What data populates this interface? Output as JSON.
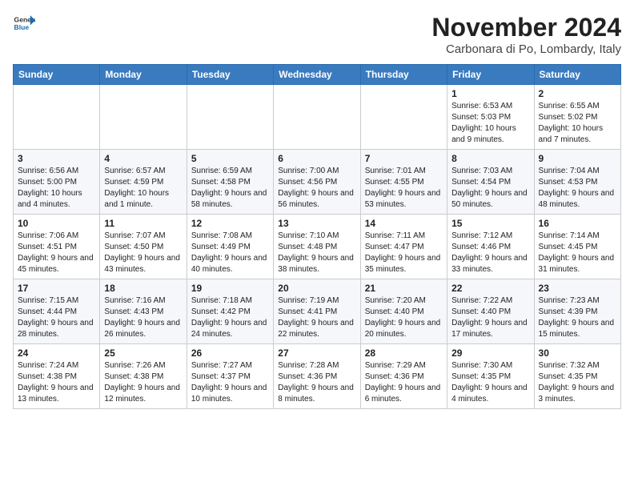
{
  "header": {
    "logo_line1": "General",
    "logo_line2": "Blue",
    "month_title": "November 2024",
    "location": "Carbonara di Po, Lombardy, Italy"
  },
  "weekdays": [
    "Sunday",
    "Monday",
    "Tuesday",
    "Wednesday",
    "Thursday",
    "Friday",
    "Saturday"
  ],
  "weeks": [
    [
      {
        "day": "",
        "info": ""
      },
      {
        "day": "",
        "info": ""
      },
      {
        "day": "",
        "info": ""
      },
      {
        "day": "",
        "info": ""
      },
      {
        "day": "",
        "info": ""
      },
      {
        "day": "1",
        "info": "Sunrise: 6:53 AM\nSunset: 5:03 PM\nDaylight: 10 hours and 9 minutes."
      },
      {
        "day": "2",
        "info": "Sunrise: 6:55 AM\nSunset: 5:02 PM\nDaylight: 10 hours and 7 minutes."
      }
    ],
    [
      {
        "day": "3",
        "info": "Sunrise: 6:56 AM\nSunset: 5:00 PM\nDaylight: 10 hours and 4 minutes."
      },
      {
        "day": "4",
        "info": "Sunrise: 6:57 AM\nSunset: 4:59 PM\nDaylight: 10 hours and 1 minute."
      },
      {
        "day": "5",
        "info": "Sunrise: 6:59 AM\nSunset: 4:58 PM\nDaylight: 9 hours and 58 minutes."
      },
      {
        "day": "6",
        "info": "Sunrise: 7:00 AM\nSunset: 4:56 PM\nDaylight: 9 hours and 56 minutes."
      },
      {
        "day": "7",
        "info": "Sunrise: 7:01 AM\nSunset: 4:55 PM\nDaylight: 9 hours and 53 minutes."
      },
      {
        "day": "8",
        "info": "Sunrise: 7:03 AM\nSunset: 4:54 PM\nDaylight: 9 hours and 50 minutes."
      },
      {
        "day": "9",
        "info": "Sunrise: 7:04 AM\nSunset: 4:53 PM\nDaylight: 9 hours and 48 minutes."
      }
    ],
    [
      {
        "day": "10",
        "info": "Sunrise: 7:06 AM\nSunset: 4:51 PM\nDaylight: 9 hours and 45 minutes."
      },
      {
        "day": "11",
        "info": "Sunrise: 7:07 AM\nSunset: 4:50 PM\nDaylight: 9 hours and 43 minutes."
      },
      {
        "day": "12",
        "info": "Sunrise: 7:08 AM\nSunset: 4:49 PM\nDaylight: 9 hours and 40 minutes."
      },
      {
        "day": "13",
        "info": "Sunrise: 7:10 AM\nSunset: 4:48 PM\nDaylight: 9 hours and 38 minutes."
      },
      {
        "day": "14",
        "info": "Sunrise: 7:11 AM\nSunset: 4:47 PM\nDaylight: 9 hours and 35 minutes."
      },
      {
        "day": "15",
        "info": "Sunrise: 7:12 AM\nSunset: 4:46 PM\nDaylight: 9 hours and 33 minutes."
      },
      {
        "day": "16",
        "info": "Sunrise: 7:14 AM\nSunset: 4:45 PM\nDaylight: 9 hours and 31 minutes."
      }
    ],
    [
      {
        "day": "17",
        "info": "Sunrise: 7:15 AM\nSunset: 4:44 PM\nDaylight: 9 hours and 28 minutes."
      },
      {
        "day": "18",
        "info": "Sunrise: 7:16 AM\nSunset: 4:43 PM\nDaylight: 9 hours and 26 minutes."
      },
      {
        "day": "19",
        "info": "Sunrise: 7:18 AM\nSunset: 4:42 PM\nDaylight: 9 hours and 24 minutes."
      },
      {
        "day": "20",
        "info": "Sunrise: 7:19 AM\nSunset: 4:41 PM\nDaylight: 9 hours and 22 minutes."
      },
      {
        "day": "21",
        "info": "Sunrise: 7:20 AM\nSunset: 4:40 PM\nDaylight: 9 hours and 20 minutes."
      },
      {
        "day": "22",
        "info": "Sunrise: 7:22 AM\nSunset: 4:40 PM\nDaylight: 9 hours and 17 minutes."
      },
      {
        "day": "23",
        "info": "Sunrise: 7:23 AM\nSunset: 4:39 PM\nDaylight: 9 hours and 15 minutes."
      }
    ],
    [
      {
        "day": "24",
        "info": "Sunrise: 7:24 AM\nSunset: 4:38 PM\nDaylight: 9 hours and 13 minutes."
      },
      {
        "day": "25",
        "info": "Sunrise: 7:26 AM\nSunset: 4:38 PM\nDaylight: 9 hours and 12 minutes."
      },
      {
        "day": "26",
        "info": "Sunrise: 7:27 AM\nSunset: 4:37 PM\nDaylight: 9 hours and 10 minutes."
      },
      {
        "day": "27",
        "info": "Sunrise: 7:28 AM\nSunset: 4:36 PM\nDaylight: 9 hours and 8 minutes."
      },
      {
        "day": "28",
        "info": "Sunrise: 7:29 AM\nSunset: 4:36 PM\nDaylight: 9 hours and 6 minutes."
      },
      {
        "day": "29",
        "info": "Sunrise: 7:30 AM\nSunset: 4:35 PM\nDaylight: 9 hours and 4 minutes."
      },
      {
        "day": "30",
        "info": "Sunrise: 7:32 AM\nSunset: 4:35 PM\nDaylight: 9 hours and 3 minutes."
      }
    ]
  ]
}
